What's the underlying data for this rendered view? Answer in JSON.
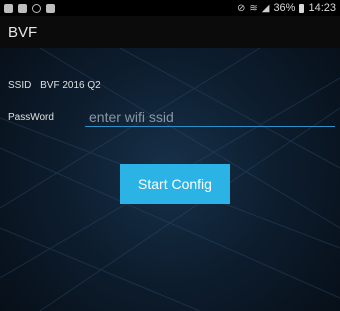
{
  "status_bar": {
    "battery_percent": "36%",
    "time": "14:23",
    "left_icons": [
      "shield-icon",
      "message-icon",
      "wifi-icon",
      "lock-icon"
    ],
    "right_icons": [
      "alarm-icon",
      "wifi-icon",
      "signal-icon",
      "battery-icon"
    ]
  },
  "app": {
    "title": "BVF"
  },
  "ssid": {
    "label": "SSID",
    "value": "BVF 2016 Q2"
  },
  "password": {
    "label": "PassWord",
    "placeholder": "enter wifi ssid",
    "value": ""
  },
  "start_button": {
    "label": "Start Config"
  },
  "colors": {
    "accent": "#2bb3e6",
    "background": "#0d1d2e",
    "underline": "#2d90c8"
  }
}
